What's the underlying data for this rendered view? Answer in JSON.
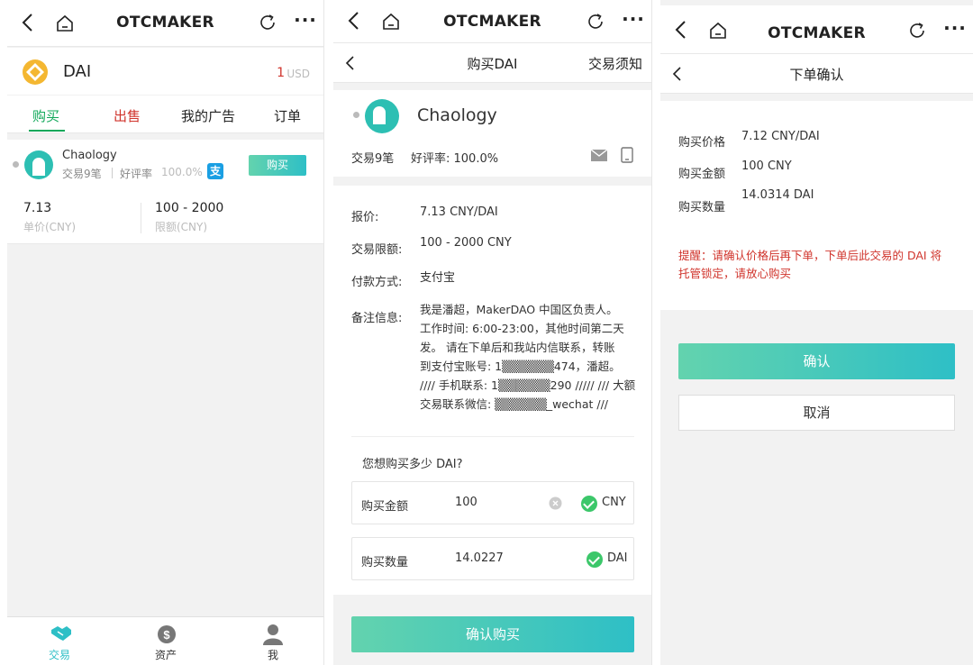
{
  "brand": "OTCMAKER",
  "p1": {
    "coin": "DAI",
    "price": "1",
    "price_unit": "USD",
    "tabs": [
      "购买",
      "出售",
      "我的广告",
      "订单"
    ],
    "ad": {
      "name": "Chaology",
      "trades": "交易9笔",
      "rating_label": "好评率",
      "rating": "100.0%",
      "pay_badge": "支",
      "buy_btn": "购买",
      "unit_price": "7.13",
      "unit_price_label": "单价(CNY)",
      "limit": "100 - 2000",
      "limit_label": "限额(CNY)"
    },
    "nav": [
      {
        "label": "交易",
        "icon": "handshake-icon"
      },
      {
        "label": "资产",
        "icon": "dollar-icon"
      },
      {
        "label": "我",
        "icon": "user-icon"
      }
    ]
  },
  "p2": {
    "sub_title": "购买DAI",
    "sub_right": "交易须知",
    "name": "Chaology",
    "trades": "交易9笔",
    "rating": "好评率: 100.0%",
    "rows": [
      {
        "label": "报价:",
        "value": "7.13 CNY/DAI"
      },
      {
        "label": "交易限额:",
        "value": "100 - 2000 CNY"
      },
      {
        "label": "付款方式:",
        "value": "支付宝"
      }
    ],
    "note_label": "备注信息:",
    "note_lines": [
      "我是潘超，MakerDAO 中国区负责人。",
      "工作时间: 6:00-23:00，其他时间第二天",
      "发。 请在下单后和我站内信联系，转账",
      "到支付宝账号: 1▒▒▒▒▒▒474，潘超。",
      "//// 手机联系: 1▒▒▒▒▒▒290 ///// /// 大额",
      "交易联系微信: ▒▒▒▒▒▒_wechat ///"
    ],
    "question": "您想购买多少 DAI?",
    "amount_label": "购买金额",
    "amount_value": "100",
    "amount_unit": "CNY",
    "qty_label": "购买数量",
    "qty_value": "14.0227",
    "qty_unit": "DAI",
    "confirm": "确认购买"
  },
  "p3": {
    "sub_title": "下单确认",
    "rows": [
      {
        "label": "购买价格",
        "value": "7.12 CNY/DAI"
      },
      {
        "label": "购买金额",
        "value": "100 CNY"
      },
      {
        "label": "购买数量",
        "value": "14.0314 DAI"
      }
    ],
    "warn_1": "提醒：请确认价格后再下单，下单后此交易的 DAI 将",
    "warn_2": "托管锁定，请放心购买",
    "confirm": "确认",
    "cancel": "取消"
  },
  "colors": {
    "accent": "#2ebfc6",
    "green": "#12a85a",
    "red": "#d0342c",
    "teal_avatar": "#2dbfb3"
  }
}
